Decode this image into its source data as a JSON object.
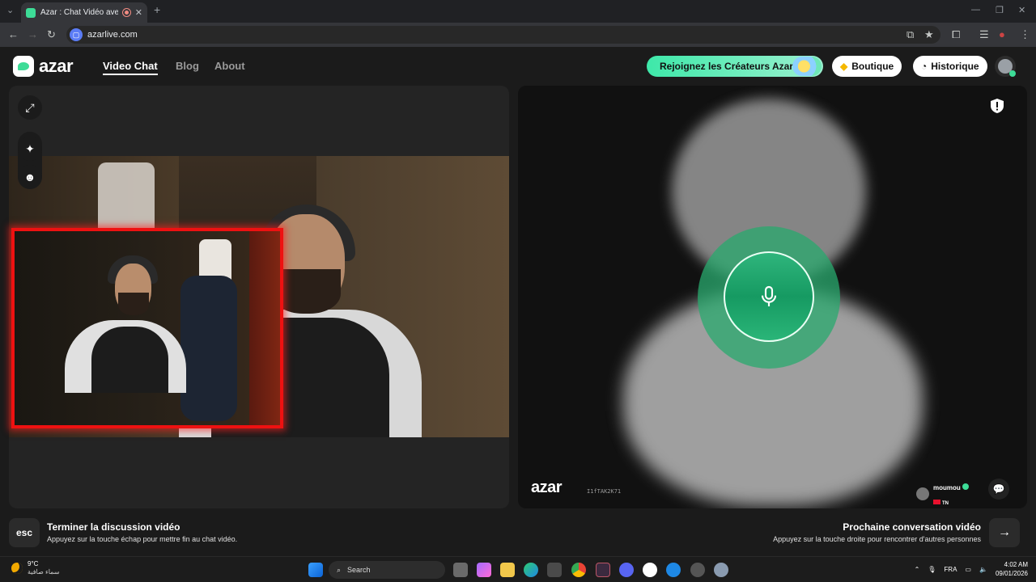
{
  "browser": {
    "tab_title": "Azar : Chat Vidéo avec de n",
    "url": "azarlive.com",
    "new_tab": "+",
    "close_tab": "✕"
  },
  "header": {
    "logo_text": "azar",
    "nav": [
      {
        "label": "Video Chat",
        "active": true
      },
      {
        "label": "Blog",
        "active": false
      },
      {
        "label": "About",
        "active": false
      }
    ],
    "creators_label": "Rejoignez les Créateurs Azar",
    "shop_label": "Boutique",
    "history_label": "Historique"
  },
  "partner": {
    "watermark": "azar",
    "id": "I1fTAK2K71",
    "name": "moumou",
    "country": "TN"
  },
  "actions": {
    "esc_key": "esc",
    "end_title": "Terminer la discussion vidéo",
    "end_sub": "Appuyez sur la touche échap pour mettre fin au chat vidéo.",
    "next_title": "Prochaine conversation vidéo",
    "next_sub": "Appuyez sur la touche droite pour rencontrer d'autres personnes",
    "next_arrow": "→"
  },
  "taskbar": {
    "weather_temp": "9°C",
    "weather_desc": "سماء صافية",
    "search_label": "Search",
    "lang": "FRA",
    "time": "4:02 AM",
    "date": "09/01/2026"
  },
  "colors": {
    "accent": "#3ddc97",
    "pip_border": "#e11111",
    "background": "#1b1b1b"
  }
}
